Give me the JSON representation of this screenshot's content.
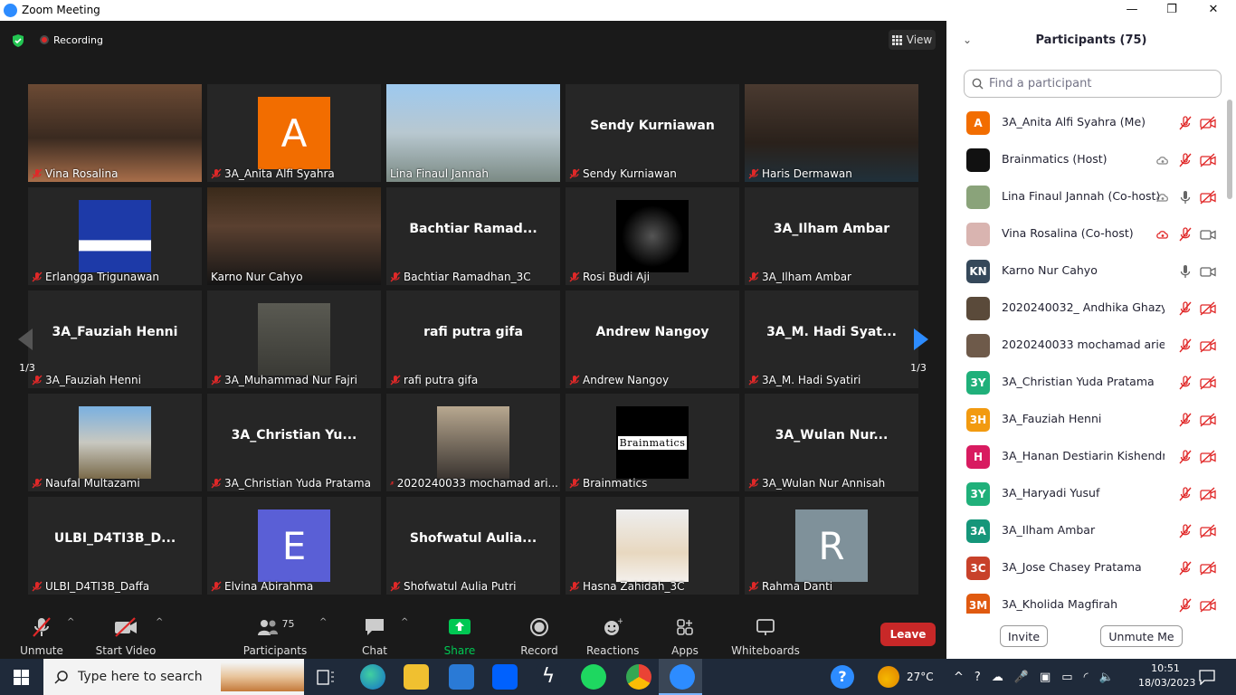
{
  "window": {
    "title": "Zoom Meeting",
    "min": "—",
    "max": "❐",
    "close": "✕"
  },
  "top": {
    "recording": "Recording",
    "view": "View"
  },
  "colors": {
    "active_border": "#c8dc5a",
    "avatar_orange": "#f26d00",
    "avatar_purple": "#5a5fd6",
    "avatar_gray": "#7f919a",
    "share_green": "#00c853",
    "leave_red": "#c82828"
  },
  "tiles": [
    {
      "type": "cam",
      "name": "Vina Rosalina",
      "muted": true
    },
    {
      "type": "avatar",
      "letter": "A",
      "name": "3A_Anita Alfi Syahra",
      "muted": true
    },
    {
      "type": "cam",
      "name": "Lina Finaul Jannah",
      "muted": false
    },
    {
      "type": "text",
      "big": "Sendy Kurniawan",
      "name": "Sendy Kurniawan",
      "muted": true
    },
    {
      "type": "cam",
      "name": "Haris Dermawan",
      "muted": true
    },
    {
      "type": "pic",
      "name": "Erlangga Trigunawan",
      "muted": true
    },
    {
      "type": "cam",
      "name": "Karno Nur Cahyo",
      "muted": false,
      "active": true
    },
    {
      "type": "text",
      "big": "Bachtiar  Ramad...",
      "name": "Bachtiar Ramadhan_3C",
      "muted": true
    },
    {
      "type": "pic",
      "name": "Rosi Budi Aji",
      "muted": true
    },
    {
      "type": "text",
      "big": "3A_Ilham Ambar",
      "name": "3A_Ilham Ambar",
      "muted": true
    },
    {
      "type": "text",
      "big": "3A_Fauziah Henni",
      "name": "3A_Fauziah Henni",
      "muted": true
    },
    {
      "type": "pic",
      "name": "3A_Muhammad Nur Fajri",
      "muted": true
    },
    {
      "type": "text",
      "big": "rafi putra gifa",
      "name": "rafi putra gifa",
      "muted": true
    },
    {
      "type": "text",
      "big": "Andrew Nangoy",
      "name": "Andrew Nangoy",
      "muted": true
    },
    {
      "type": "text",
      "big": "3A_M.  Hadi Syat...",
      "name": "3A_M. Hadi Syatiri",
      "muted": true
    },
    {
      "type": "pic",
      "name": "Naufal Multazami",
      "muted": true
    },
    {
      "type": "text",
      "big": "3A_Christian  Yu...",
      "name": "3A_Christian Yuda Pratama",
      "muted": true
    },
    {
      "type": "pic",
      "name": "2020240033 mochamad ari...",
      "muted": true
    },
    {
      "type": "brain",
      "name": "Brainmatics",
      "muted": true
    },
    {
      "type": "text",
      "big": "3A_Wulan  Nur...",
      "name": "3A_Wulan Nur Annisah",
      "muted": true
    },
    {
      "type": "text",
      "big": "ULBI_D4TI3B_D...",
      "name": "ULBI_D4TI3B_Daffa",
      "muted": true
    },
    {
      "type": "avatar",
      "letter": "E",
      "name": "Elvina Abirahma",
      "muted": true
    },
    {
      "type": "text",
      "big": "Shofwatul  Aulia...",
      "name": "Shofwatul Aulia Putri",
      "muted": true
    },
    {
      "type": "pic",
      "name": "Hasna Zahidah_3C",
      "muted": true
    },
    {
      "type": "avatar",
      "letter": "R",
      "name": "Rahma Danti",
      "muted": true
    }
  ],
  "pager": {
    "left": "1/3",
    "right": "1/3"
  },
  "brain_text": "Brainmatics",
  "toolbar": {
    "unmute": "Unmute",
    "start_video": "Start Video",
    "participants": "Participants",
    "participants_count": "75",
    "chat": "Chat",
    "share": "Share Screen",
    "record": "Record",
    "reactions": "Reactions",
    "apps": "Apps",
    "whiteboards": "Whiteboards",
    "leave": "Leave"
  },
  "panel": {
    "title": "Participants (75)",
    "search_placeholder": "Find a participant",
    "invite": "Invite",
    "unmute_me": "Unmute Me",
    "rows": [
      {
        "initials": "A",
        "color": "#f26d00",
        "name": "3A_Anita Alfi Syahra (Me)",
        "mic": "muted",
        "video": "off"
      },
      {
        "initials": "",
        "color": "#111111",
        "name": "Brainmatics (Host)",
        "mic": "muted",
        "video": "off",
        "cloud": true
      },
      {
        "initials": "",
        "color": "#8aa37a",
        "name": "Lina Finaul Jannah (Co-host)",
        "mic": "on",
        "video": "off",
        "cloud": true
      },
      {
        "initials": "",
        "color": "#d9b4b0",
        "name": "Vina Rosalina (Co-host)",
        "mic": "muted",
        "video": "on",
        "cloud": true,
        "cloud_red": true
      },
      {
        "initials": "KN",
        "color": "#35485a",
        "name": "Karno Nur Cahyo",
        "mic": "on",
        "video": "on"
      },
      {
        "initials": "",
        "color": "#5a4a3a",
        "name": "2020240032_ Andhika Ghazy D...",
        "mic": "muted",
        "video": "off"
      },
      {
        "initials": "",
        "color": "#6e5a4a",
        "name": "2020240033 mochamad arief a...",
        "mic": "muted",
        "video": "off"
      },
      {
        "initials": "3Y",
        "color": "#20b07a",
        "name": "3A_Christian Yuda Pratama",
        "mic": "muted",
        "video": "off"
      },
      {
        "initials": "3H",
        "color": "#f29a10",
        "name": "3A_Fauziah Henni",
        "mic": "muted",
        "video": "off"
      },
      {
        "initials": "H",
        "color": "#d81b60",
        "name": "3A_Hanan Destiarin Kishendrian",
        "mic": "muted",
        "video": "off"
      },
      {
        "initials": "3Y",
        "color": "#20b07a",
        "name": "3A_Haryadi Yusuf",
        "mic": "muted",
        "video": "off"
      },
      {
        "initials": "3A",
        "color": "#15967a",
        "name": "3A_Ilham Ambar",
        "mic": "muted",
        "video": "off"
      },
      {
        "initials": "3C",
        "color": "#c8412a",
        "name": "3A_Jose Chasey Pratama",
        "mic": "muted",
        "video": "off"
      },
      {
        "initials": "3M",
        "color": "#e05a10",
        "name": "3A_Kholida Magfirah",
        "mic": "muted",
        "video": "off"
      }
    ]
  },
  "taskbar": {
    "search": "Type here to search",
    "temp": "27°C",
    "time": "10:51",
    "date": "18/03/2023"
  }
}
